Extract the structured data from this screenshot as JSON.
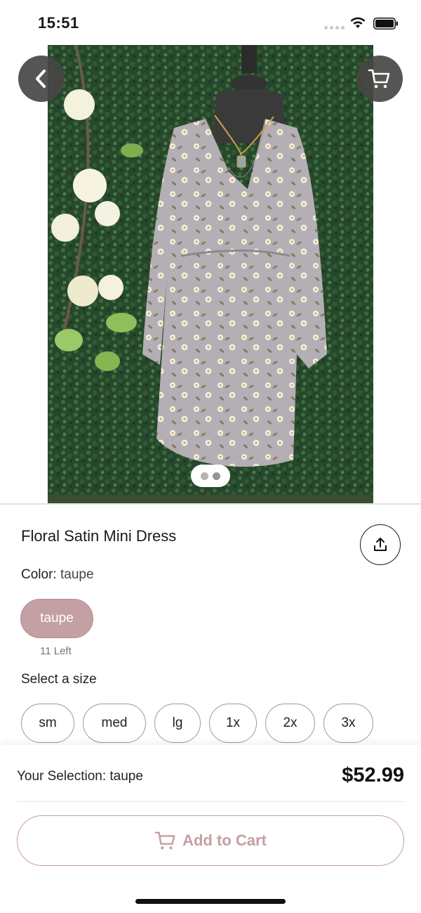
{
  "status_bar": {
    "time": "15:51"
  },
  "product": {
    "title": "Floral Satin Mini Dress",
    "color_label": "Color:",
    "color_value": "taupe",
    "swatch_label": "taupe",
    "stock_text": "11 Left",
    "size_prompt": "Select a size",
    "sizes": [
      "sm",
      "med",
      "lg",
      "1x",
      "2x",
      "3x"
    ]
  },
  "carousel": {
    "page_count": 2,
    "current_page": 2
  },
  "footer": {
    "selection_text": "Your Selection: taupe",
    "price": "$52.99",
    "add_to_cart_label": "Add to Cart"
  },
  "colors": {
    "accent": "#c49fa3",
    "nav_button_bg": "#464644",
    "text_primary": "#1a1a1a"
  },
  "icons": {
    "back": "chevron-left-icon",
    "cart": "cart-icon",
    "share": "share-icon",
    "wifi": "wifi-icon",
    "battery": "battery-icon"
  }
}
